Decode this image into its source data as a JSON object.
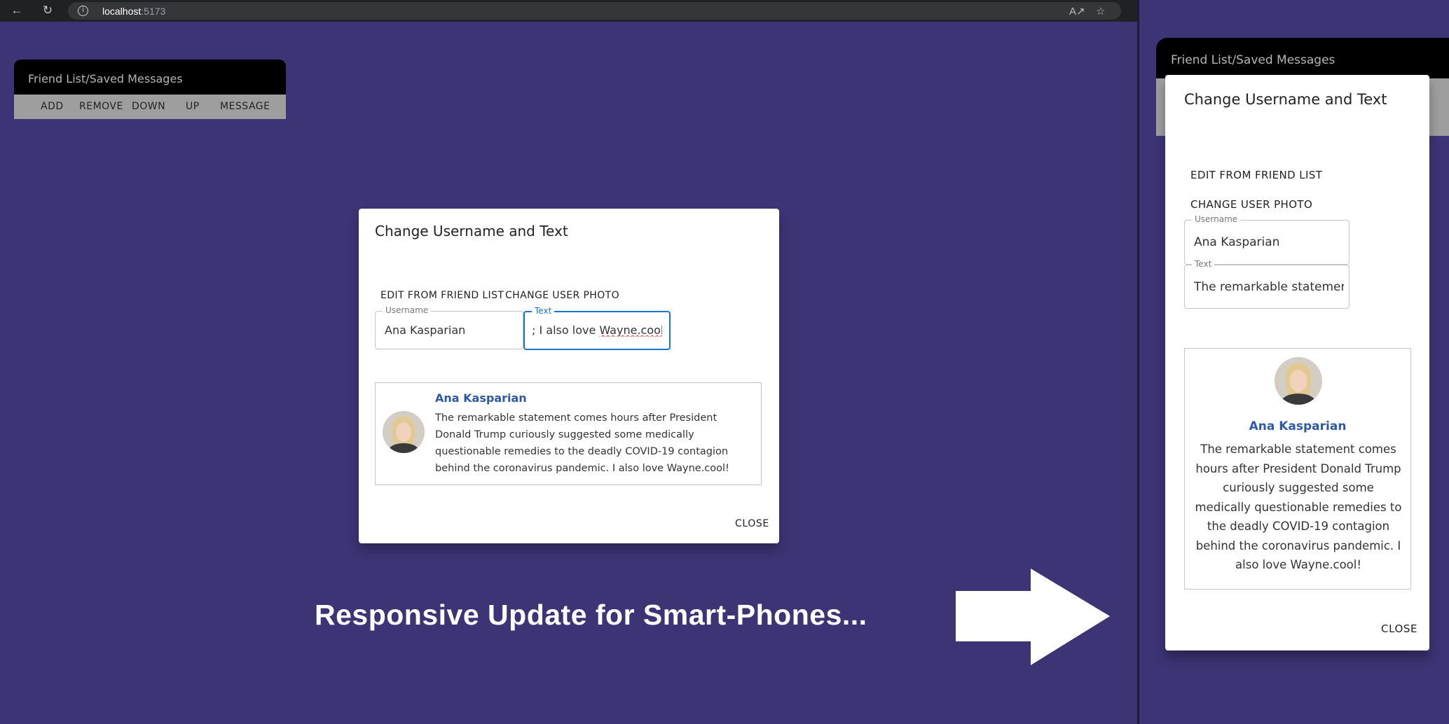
{
  "browser": {
    "host": "localhost",
    "port": ":5173",
    "icons": [
      "back-icon",
      "reload-icon",
      "info-icon",
      "read-aloud-icon",
      "star-icon"
    ]
  },
  "app": {
    "title": "Friend List/Saved Messages",
    "toolbar": [
      "ADD",
      "REMOVE",
      "DOWN",
      "UP",
      "MESSAGE"
    ]
  },
  "dialog": {
    "title": "Change Username and Text",
    "edit_link": "EDIT FROM FRIEND LIST",
    "photo_link": "CHANGE USER PHOTO",
    "username_label": "Username",
    "username_value": "Ana Kasparian",
    "text_label": "Text",
    "text_value_prefix": "; I also love ",
    "text_value_link": "Wayne.cool!",
    "preview_name": "Ana Kasparian",
    "preview_text": "The remarkable statement comes hours after President Donald Trump curiously suggested some medically questionable remedies to the deadly COVID-19 contagion behind the coronavirus pandemic. I also love Wayne.cool!",
    "close": "CLOSE"
  },
  "caption": "Responsive Update for Smart-Phones...",
  "mobile": {
    "app_title": "Friend List/Saved Messages",
    "title": "Change Username and Text",
    "edit_link": "EDIT FROM FRIEND LIST",
    "photo_link": "CHANGE USER PHOTO",
    "username_label": "Username",
    "username_value": "Ana Kasparian",
    "text_label": "Text",
    "text_value": "The remarkable statemer",
    "preview_name": "Ana Kasparian",
    "preview_text": "The remarkable statement comes hours after President Donald Trump curiously suggested some medically questionable remedies to the deadly COVID-19 contagion behind the coronavirus pandemic. I also love Wayne.cool!",
    "close": "CLOSE"
  },
  "colors": {
    "background": "#3d3476",
    "accent": "#1976d2",
    "name": "#2e58a8",
    "toolbar": "#9e9e9e"
  }
}
